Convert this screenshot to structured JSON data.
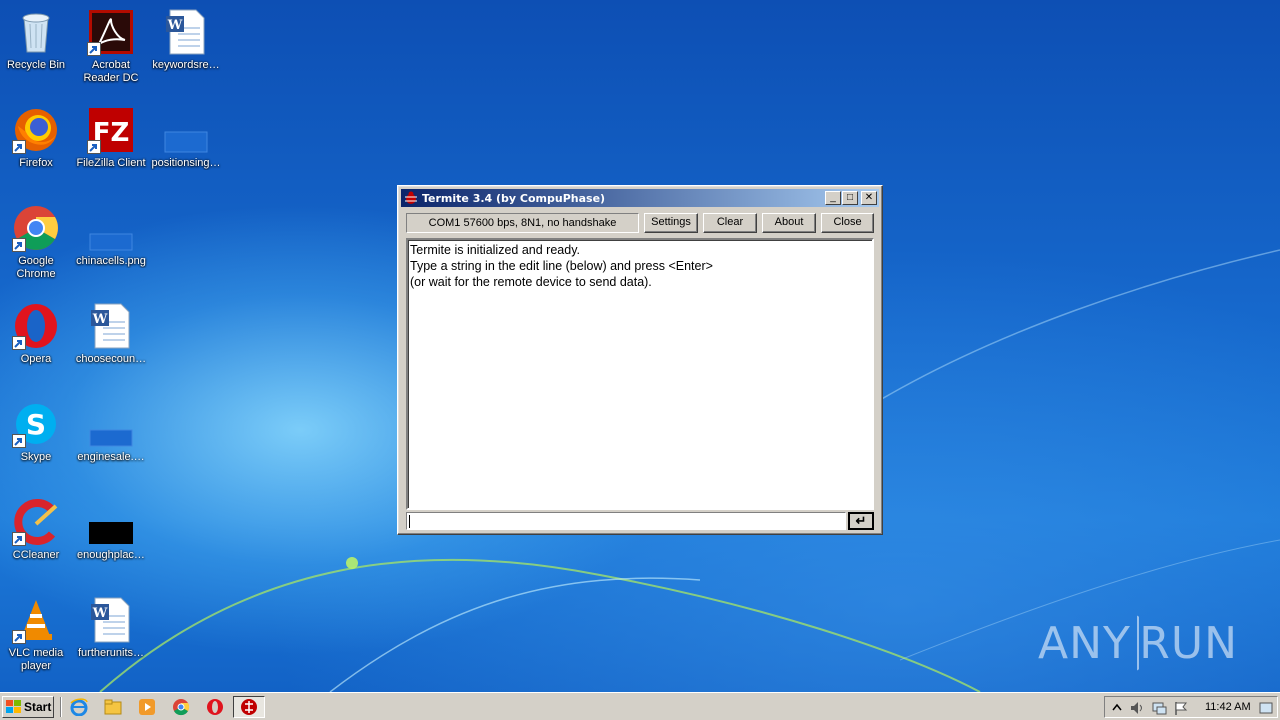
{
  "desktop_icons": [
    {
      "label": "Recycle Bin",
      "icon": "recycle-bin-icon"
    },
    {
      "label": "Acrobat\nReader DC",
      "icon": "acrobat-reader-icon"
    },
    {
      "label": "keywordsre…",
      "icon": "word-document-icon"
    },
    {
      "label": "Firefox",
      "icon": "firefox-icon"
    },
    {
      "label": "FileZilla Client",
      "icon": "filezilla-icon"
    },
    {
      "label": "positionsing…",
      "icon": "image-file-icon"
    },
    {
      "label": "Google\nChrome",
      "icon": "chrome-icon"
    },
    {
      "label": "chinacells.png",
      "icon": "image-file-icon"
    },
    {
      "label": "Opera",
      "icon": "opera-icon"
    },
    {
      "label": "choosecoun…",
      "icon": "word-document-icon"
    },
    {
      "label": "Skype",
      "icon": "skype-icon"
    },
    {
      "label": "enginesale.…",
      "icon": "image-file-icon"
    },
    {
      "label": "CCleaner",
      "icon": "ccleaner-icon"
    },
    {
      "label": "enoughplac…",
      "icon": "black-image-icon"
    },
    {
      "label": "VLC media\nplayer",
      "icon": "vlc-icon"
    },
    {
      "label": "furtherunits…",
      "icon": "word-document-icon"
    }
  ],
  "window": {
    "title": "Termite 3.4 (by CompuPhase)",
    "status": "COM1 57600 bps, 8N1, no handshake",
    "buttons": {
      "settings": "Settings",
      "clear": "Clear",
      "about": "About",
      "close": "Close"
    },
    "output_lines": [
      "Termite is initialized and ready.",
      "Type a string in the edit line (below) and press <Enter>",
      "(or wait for the remote device to send data)."
    ],
    "input_value": "",
    "send_glyph": "↵"
  },
  "taskbar": {
    "start_label": "Start",
    "clock": "11:42 AM",
    "quick_launch": [
      "internet-explorer-icon",
      "explorer-icon",
      "media-player-icon",
      "chrome-icon",
      "opera-icon"
    ]
  },
  "watermark": {
    "left": "ANY",
    "right": "RUN"
  },
  "colors": {
    "title_active_start": "#0a246a",
    "title_active_end": "#a6caf0",
    "window_face": "#d4d0c8",
    "desktop": "#1668cc"
  }
}
